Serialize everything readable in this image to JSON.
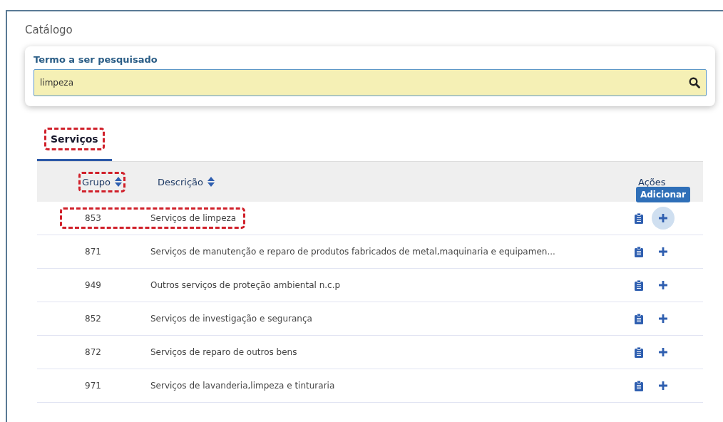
{
  "title": "Catálogo",
  "search": {
    "label": "Termo a ser pesquisado",
    "value": "limpeza"
  },
  "tabs": [
    {
      "label": "Serviços",
      "selected": true,
      "highlighted": true
    }
  ],
  "table": {
    "columns": [
      {
        "label": "Grupo",
        "sortable": true,
        "highlighted": true
      },
      {
        "label": "Descrição",
        "sortable": true,
        "highlighted": false
      },
      {
        "label": "Ações",
        "sortable": false,
        "highlighted": false
      }
    ],
    "tooltip": "Adicionar",
    "rows": [
      {
        "grupo": "853",
        "descricao": "Serviços de limpeza",
        "highlighted": true,
        "hovered": true
      },
      {
        "grupo": "871",
        "descricao": "Serviços de manutenção e reparo de produtos fabricados de metal,maquinaria e equipamen...",
        "highlighted": false,
        "hovered": false
      },
      {
        "grupo": "949",
        "descricao": "Outros serviços de proteção ambiental n.c.p",
        "highlighted": false,
        "hovered": false
      },
      {
        "grupo": "852",
        "descricao": "Serviços de investigação e segurança",
        "highlighted": false,
        "hovered": false
      },
      {
        "grupo": "872",
        "descricao": "Serviços de reparo de outros bens",
        "highlighted": false,
        "hovered": false
      },
      {
        "grupo": "971",
        "descricao": "Serviços de lavanderia,limpeza e tinturaria",
        "highlighted": false,
        "hovered": false
      }
    ]
  }
}
